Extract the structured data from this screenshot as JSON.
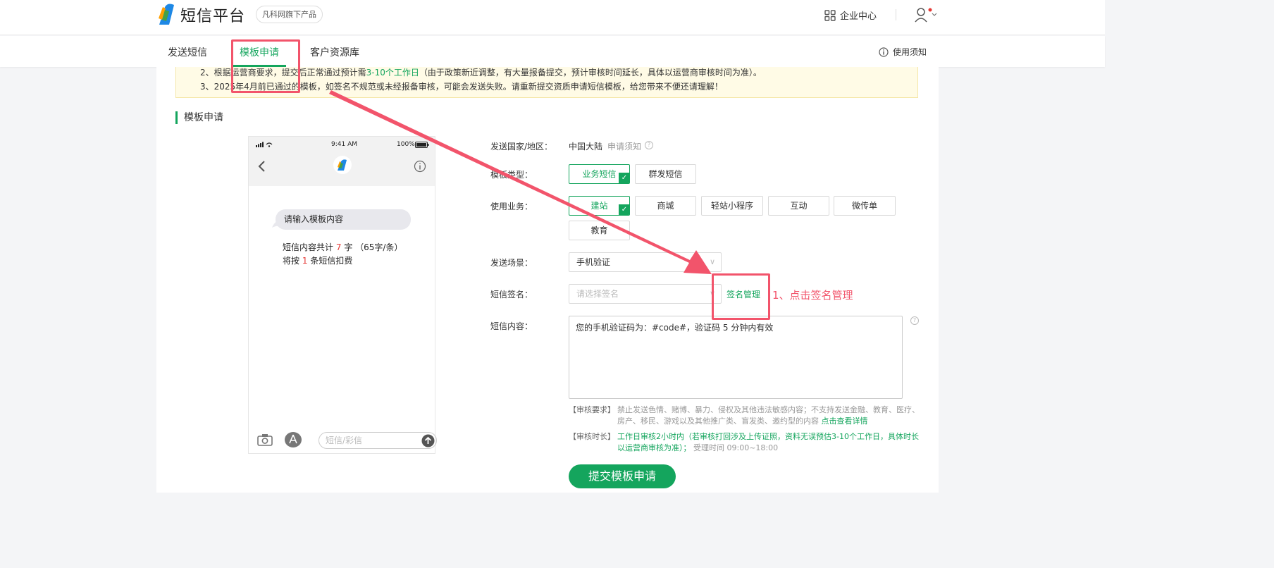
{
  "header": {
    "brand": "短信平台",
    "badge": "凡科网旗下产品",
    "enterprise": "企业中心"
  },
  "nav": {
    "tabs": [
      {
        "label": "发送短信"
      },
      {
        "label": "模板申请"
      },
      {
        "label": "客户资源库"
      }
    ],
    "active_tab": "模板申请",
    "help": "使用须知"
  },
  "notice": {
    "line2_a": "2、根据运营商要求，提交后正常通过预计需",
    "line2_hl": "3-10个工作日",
    "line2_b": "（由于政策新近调整，有大量报备提交，预计审核时间延长，具体以运营商审核时间为准）。",
    "line3": "3、2025年4月前已通过的模板，如签名不规范或未经报备审核，可能会发送失败。请重新提交资质申请短信模板，给您带来不便还请理解！"
  },
  "section_title": "模板申请",
  "phone": {
    "time": "9:41 AM",
    "battery": "100%",
    "bubble": "请输入模板内容",
    "count_a": "短信内容共计",
    "count_chars": "7",
    "count_b": "字 （65字/条）将按",
    "count_msgs": "1",
    "count_c": "条短信扣费",
    "input_placeholder": "短信/彩信"
  },
  "form": {
    "country_label": "发送国家/地区：",
    "country_value": "中国大陆",
    "country_note": "申请须知",
    "type_label": "模板类型：",
    "types": [
      "业务短信",
      "群发短信"
    ],
    "biz_label": "使用业务：",
    "biz": [
      "建站",
      "商城",
      "轻站小程序",
      "互动",
      "微传单",
      "教育"
    ],
    "scene_label": "发送场景：",
    "scene_value": "手机验证",
    "sign_label": "短信签名：",
    "sign_placeholder": "请选择签名",
    "sign_manage": "签名管理",
    "content_label": "短信内容：",
    "content_value": "您的手机验证码为：#code#，验证码 5 分钟内有效",
    "review_req_key": "【审核要求】",
    "review_req_text": "禁止发送色情、赌博、暴力、侵权及其他违法敏感内容；不支持发送金融、教育、医疗、房产、移民、游戏以及其他推广类、盲发类、邀约型的内容",
    "review_req_link": "点击查看详情",
    "review_time_key": "【审核时长】",
    "review_time_text": "工作日审核2小时内（若审核打回涉及上传证照，资料无误预估3-10个工作日，具体时长以运营商审核为准）；",
    "review_time_hours": "受理时间 09:00~18:00",
    "submit": "提交模板申请"
  },
  "annotation": "1、点击签名管理",
  "colors": {
    "accent": "#14a55d",
    "annotation": "#f2546b"
  }
}
